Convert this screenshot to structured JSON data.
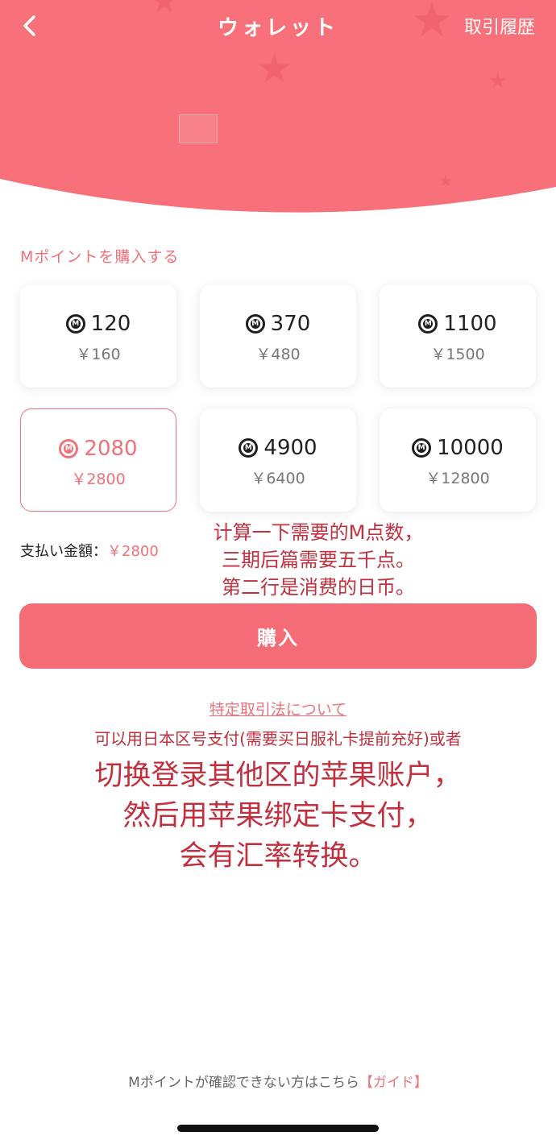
{
  "header": {
    "title": "ウォレット",
    "history_label": "取引履歴",
    "bg_color": "#f87079"
  },
  "purchase": {
    "section_label": "Mポイントを購入する",
    "options": [
      {
        "points": "120",
        "price": "￥160",
        "selected": false
      },
      {
        "points": "370",
        "price": "￥480",
        "selected": false
      },
      {
        "points": "1100",
        "price": "￥1500",
        "selected": false
      },
      {
        "points": "2080",
        "price": "￥2800",
        "selected": true
      },
      {
        "points": "4900",
        "price": "￥6400",
        "selected": false
      },
      {
        "points": "10000",
        "price": "￥12800",
        "selected": false
      }
    ],
    "pay_label": "支払い金額：",
    "pay_amount": "￥2800",
    "buy_label": "購入",
    "law_link": "特定取引法について"
  },
  "annotations": {
    "note1": [
      "计算一下需要的M点数，",
      "三期后篇需要五千点。",
      "第二行是消费的日币。"
    ],
    "note2_small": "可以用日本区号支付(需要买日服礼卡提前充好)或者",
    "note2": [
      "切换登录其他区的苹果账户，",
      "然后用苹果绑定卡支付，",
      "会有汇率转换。"
    ]
  },
  "footer": {
    "text": "Mポイントが確認できない方はこちら",
    "guide": "【ガイド】"
  },
  "colors": {
    "accent": "#f0717a",
    "button": "#f46c75",
    "annotation": "#c0303e"
  }
}
